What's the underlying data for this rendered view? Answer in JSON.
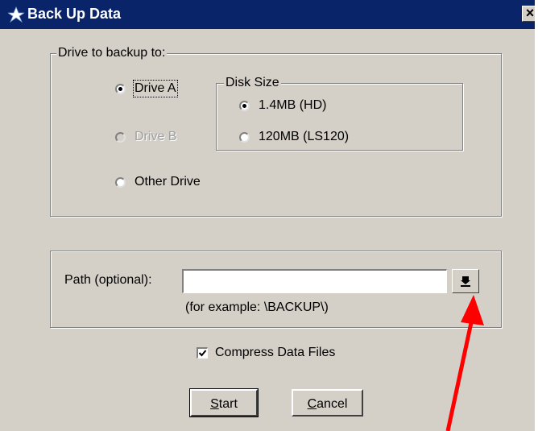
{
  "window": {
    "title": "Back Up Data",
    "close_symbol": "×",
    "title_icon": "app-icon",
    "close_icon": "close-icon"
  },
  "drive_group": {
    "legend": "Drive to backup to:",
    "options": [
      {
        "label": "Drive A",
        "checked": true,
        "enabled": true
      },
      {
        "label": "Drive B",
        "checked": false,
        "enabled": false
      },
      {
        "label": "Other Drive",
        "checked": false,
        "enabled": true
      }
    ]
  },
  "disk_size_group": {
    "legend": "Disk Size",
    "options": [
      {
        "label": "1.4MB (HD)",
        "checked": true
      },
      {
        "label": "120MB (LS120)",
        "checked": false
      }
    ]
  },
  "path_group": {
    "label": "Path (optional):",
    "value": "",
    "hint": "(for example: \\BACKUP\\)",
    "browse_icon": "down-arrow-icon"
  },
  "compress": {
    "label": "Compress Data Files",
    "checked": true
  },
  "buttons": {
    "start": "Start",
    "cancel": "Cancel"
  },
  "annotation": {
    "color": "#ff0000",
    "icon": "red-arrow-annotation"
  },
  "colors": {
    "titlebar": "#0a246a",
    "dialog_face": "#d4d0c8"
  }
}
